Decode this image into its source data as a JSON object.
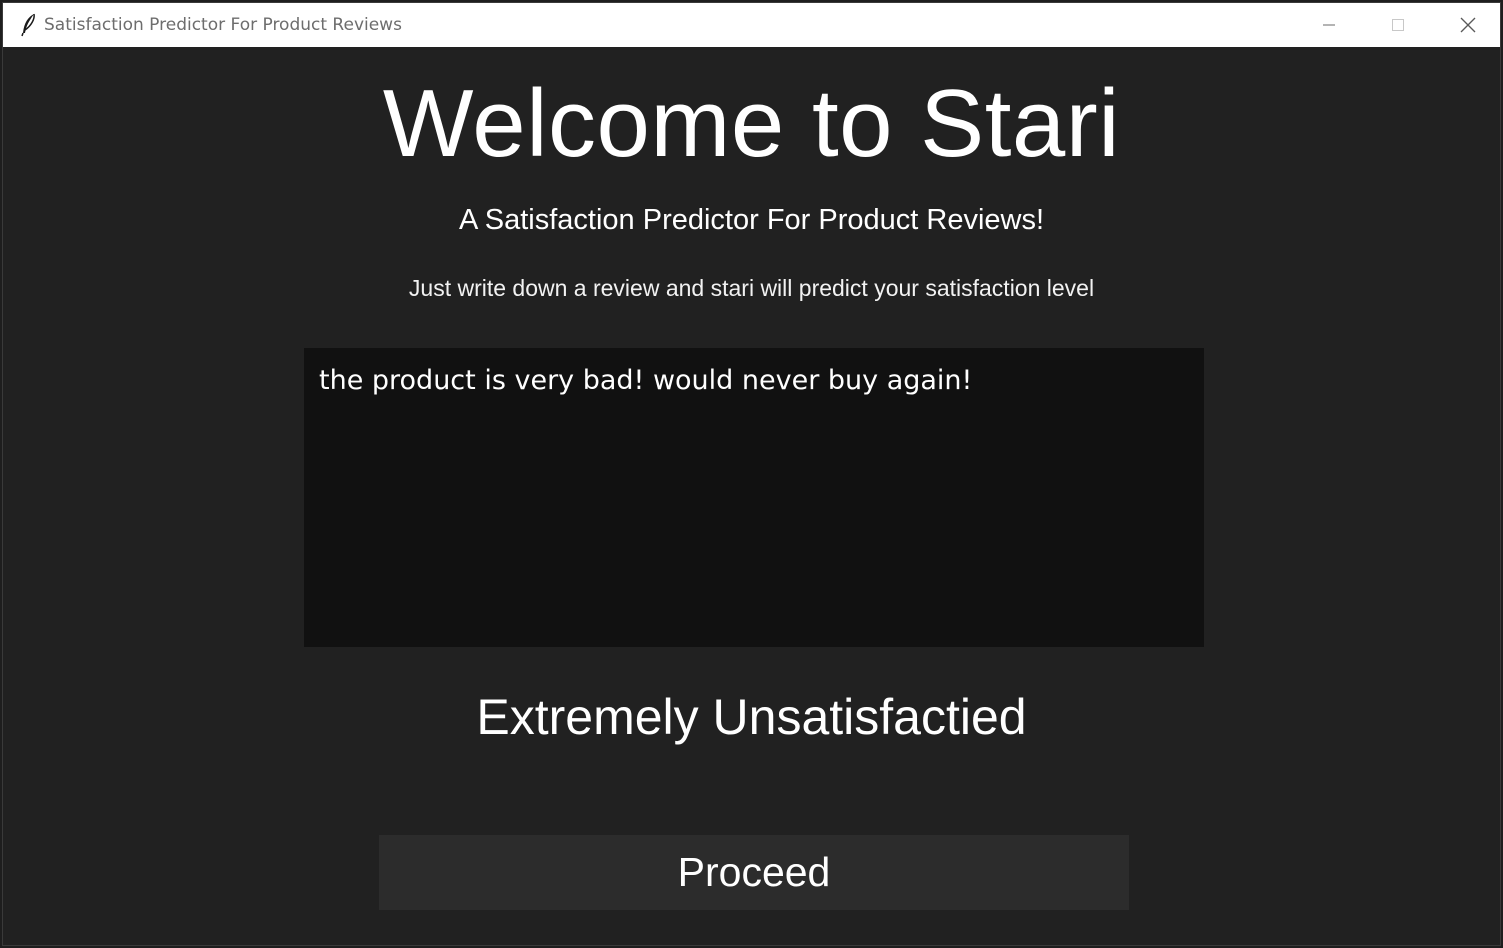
{
  "window": {
    "title": "Satisfaction Predictor For Product Reviews",
    "app_icon": "feather-icon",
    "controls": {
      "minimize_icon": "minimize-icon",
      "maximize_icon": "maximize-icon",
      "close_icon": "close-icon"
    }
  },
  "main": {
    "title": "Welcome to Stari",
    "subtitle": "A Satisfaction Predictor For Product Reviews!",
    "instructions": "Just write down a review and stari will predict your satisfaction level",
    "review_text": "the product is very bad! would never buy again!",
    "prediction": "Extremely Unsatisfactied",
    "proceed_label": "Proceed"
  },
  "colors": {
    "background": "#212121",
    "text_box": "#111111",
    "button": "#2c2c2c",
    "text": "#ffffff",
    "titlebar": "#ffffff"
  }
}
